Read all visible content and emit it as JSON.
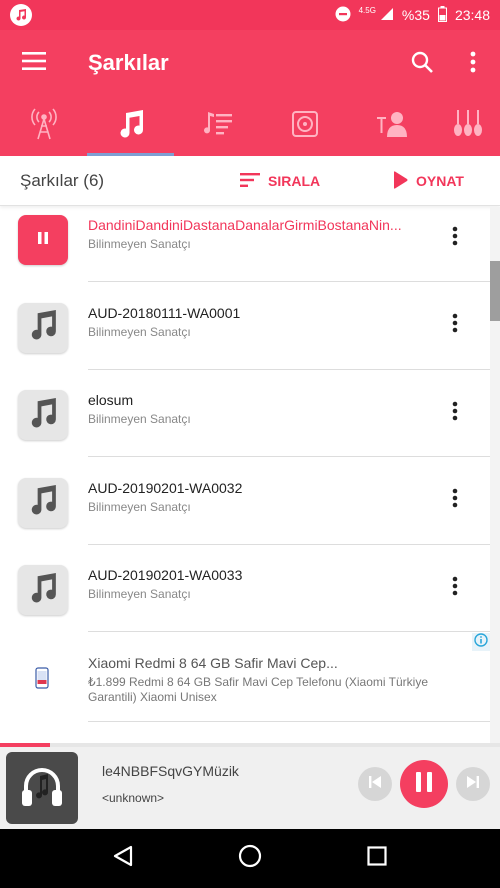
{
  "status_bar": {
    "app_icon": "music-note-icon",
    "network_type": "4.5G",
    "battery": "%35",
    "time": "23:48"
  },
  "toolbar": {
    "title": "Şarkılar",
    "menu_icon": "hamburger-icon",
    "search_icon": "search-icon",
    "more_icon": "more-vert-icon"
  },
  "tabs": [
    {
      "icon": "radio-tower-icon"
    },
    {
      "icon": "music-note-icon",
      "active": true
    },
    {
      "icon": "playlist-icon"
    },
    {
      "icon": "album-icon"
    },
    {
      "icon": "artist-icon"
    },
    {
      "icon": "instruments-icon"
    }
  ],
  "header": {
    "count_label": "Şarkılar (6)",
    "sort_label": "SIRALA",
    "play_label": "OYNAT"
  },
  "songs": [
    {
      "title": "DandiniDandiniDastanaDanalarGirmiBostanaNin...",
      "artist": "Bilinmeyen Sanatçı",
      "playing": true
    },
    {
      "title": "AUD-20180111-WA0001",
      "artist": "Bilinmeyen Sanatçı"
    },
    {
      "title": "elosum",
      "artist": "Bilinmeyen Sanatçı"
    },
    {
      "title": "AUD-20190201-WA0032",
      "artist": "Bilinmeyen Sanatçı"
    },
    {
      "title": "AUD-20190201-WA0033",
      "artist": "Bilinmeyen Sanatçı"
    }
  ],
  "ad": {
    "title": "Xiaomi Redmi 8 64 GB Safir Mavi Cep...",
    "description": "₺1.899 Redmi 8 64 GB Safir Mavi Cep Telefonu (Xiaomi Türkiye Garantili) Xiaomi Unisex",
    "info_icon": "info-icon"
  },
  "now_playing": {
    "title": "le4NBBFSqvGYMüzik",
    "artist": "<unknown>",
    "progress": 0.1
  },
  "colors": {
    "accent": "#f43f60",
    "status_bar": "#f2365a"
  }
}
